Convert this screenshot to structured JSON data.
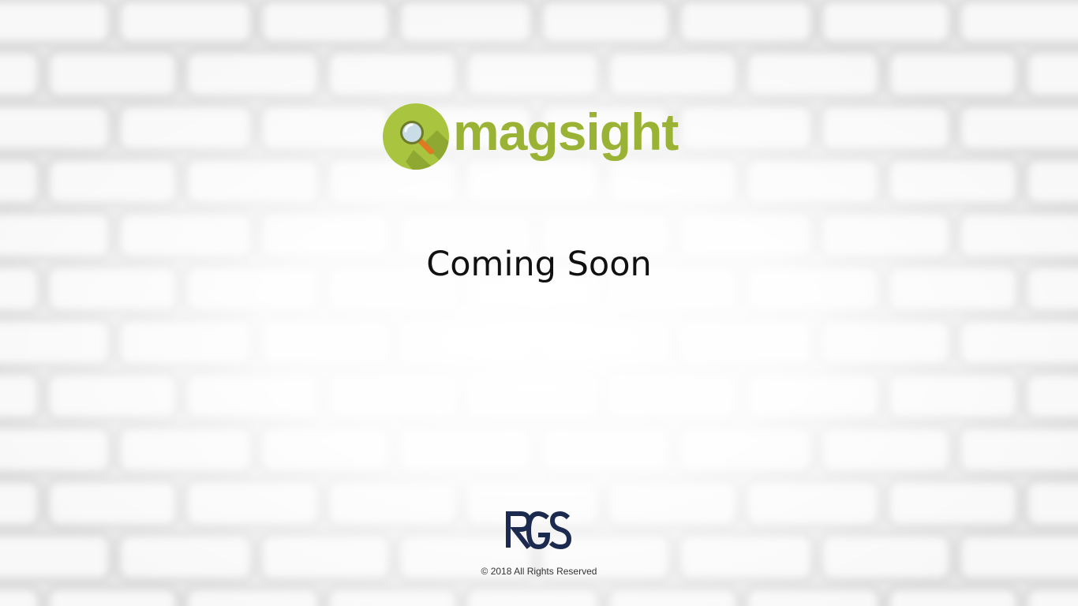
{
  "brand": {
    "name": "magsight",
    "color": "#9bb335",
    "icon": "magnifier-icon"
  },
  "main": {
    "heading": "Coming Soon"
  },
  "footer": {
    "company_logo": "RGS",
    "company_color": "#1b2a4e",
    "copyright": "© 2018 All Rights Reserved"
  }
}
